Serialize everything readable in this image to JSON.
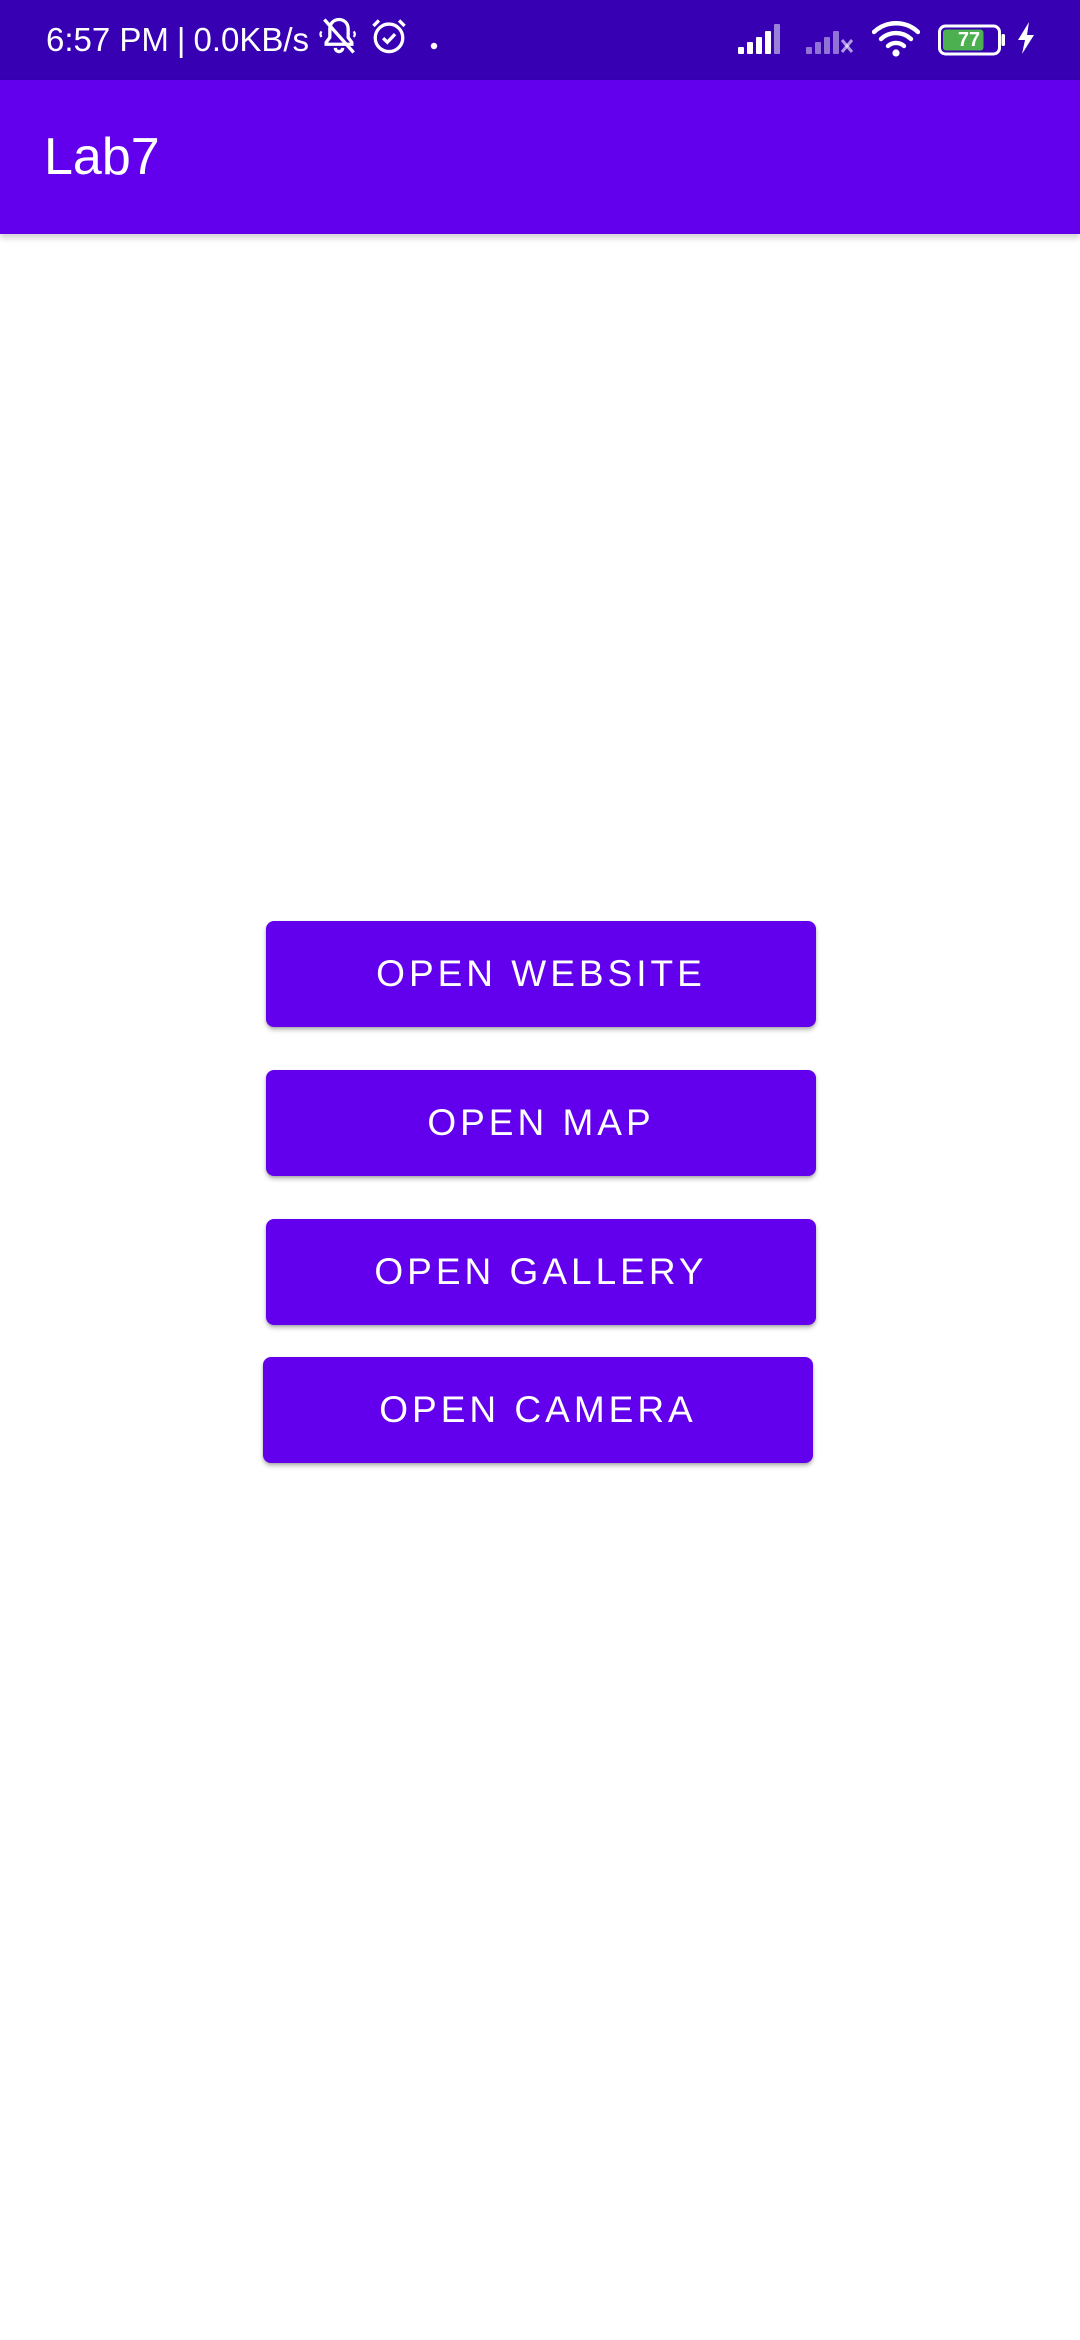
{
  "status_bar": {
    "time": "6:57 PM",
    "separator": "|",
    "network_speed": "0.0KB/s",
    "icons_left": [
      "muted-bell-icon",
      "alarm-icon",
      "dot-icon"
    ],
    "icons_right": [
      "signal-icon",
      "signal-no-service-icon",
      "wifi-icon",
      "battery-icon",
      "charging-icon"
    ],
    "battery_level": "77",
    "colors": {
      "background": "#3700b3",
      "battery_fill": "#4caf50"
    }
  },
  "app_bar": {
    "title": "Lab7",
    "color": "#6200ee"
  },
  "buttons": {
    "website": "OPEN WEBSITE",
    "map": "OPEN MAP",
    "gallery": "OPEN GALLERY",
    "camera": "OPEN CAMERA",
    "color": "#6200ee"
  }
}
